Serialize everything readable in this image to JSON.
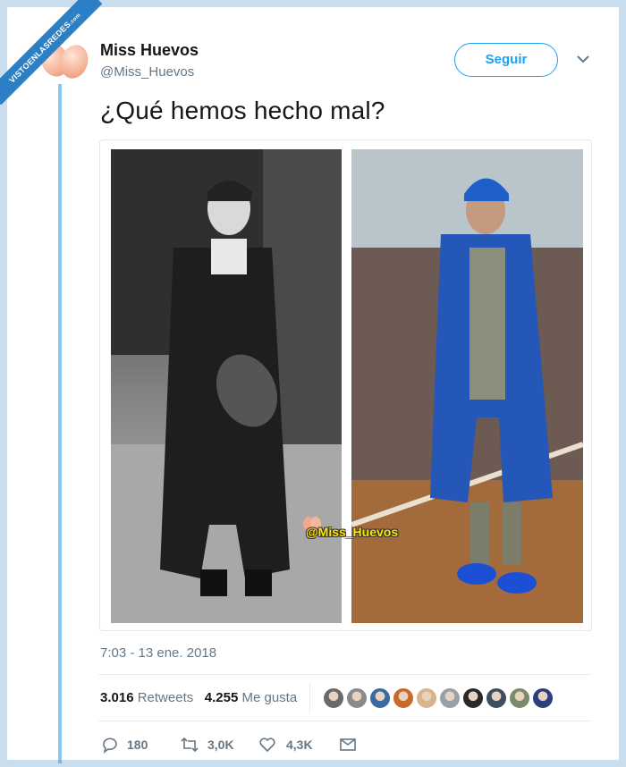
{
  "watermark_ribbon": {
    "line1": "VISTOENLASREDES",
    "line2": ".com"
  },
  "user": {
    "name": "Miss Huevos",
    "handle": "@Miss_Huevos"
  },
  "follow_label": "Seguir",
  "tweet": {
    "text": "¿Qué hemos hecho mal?",
    "timestamp": "7:03 - 13 ene. 2018"
  },
  "media": {
    "watermark": "@Miss_Huevos"
  },
  "stats": {
    "retweets_count": "3.016",
    "retweets_label": "Retweets",
    "likes_count": "4.255",
    "likes_label": "Me gusta"
  },
  "actions": {
    "replies": "180",
    "retweets": "3,0K",
    "likes": "4,3K"
  },
  "liker_colors": [
    "#6a6a6a",
    "#8a8a8a",
    "#3b6aa0",
    "#c86a2a",
    "#d9b48a",
    "#9aa0a8",
    "#2a2a2a",
    "#3f4e5e",
    "#7a8a6a",
    "#2b3f7a"
  ],
  "colors": {
    "accent": "#1da1f2",
    "muted": "#657786",
    "background": "#c9dff0"
  }
}
